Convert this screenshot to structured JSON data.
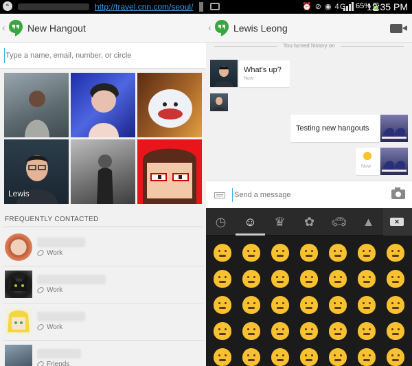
{
  "left": {
    "status": {
      "url": "http://travel.cnn.com/seoul/"
    },
    "appbar": {
      "title": "New Hangout"
    },
    "search": {
      "placeholder": "Type a name, email, number, or circle"
    },
    "grid": {
      "tiles": [
        {
          "label": ""
        },
        {
          "label": ""
        },
        {
          "label": ""
        },
        {
          "label": "Lewis"
        },
        {
          "label": ""
        },
        {
          "label": ""
        }
      ]
    },
    "frequent": {
      "heading": "FREQUENTLY CONTACTED",
      "contacts": [
        {
          "circle": "Work"
        },
        {
          "circle": "Work"
        },
        {
          "circle": "Work"
        },
        {
          "circle": "Friends"
        }
      ]
    }
  },
  "right": {
    "status": {
      "icons": "⏰ ⊘ ◉ 4G",
      "battery": "65%",
      "time": "12:35 PM",
      "battery_level": 0.65
    },
    "appbar": {
      "title": "Lewis Leong"
    },
    "history_note": "You turned history on",
    "messages": [
      {
        "text": "What's up?",
        "time": "Now",
        "direction": "in"
      },
      {
        "text": "Testing new hangouts",
        "time": "",
        "direction": "out"
      },
      {
        "text": "",
        "time": "Now",
        "direction": "out"
      }
    ],
    "composer": {
      "placeholder": "Send a message"
    },
    "emoji_tabs": [
      "recent-icon",
      "smiley-icon",
      "crown-icon",
      "flower-icon",
      "car-icon",
      "triangle-icon"
    ],
    "colors": {
      "accent": "#33b5e5",
      "hangouts_green": "#3aa63e",
      "emoji_yellow": "#f7c130"
    }
  }
}
